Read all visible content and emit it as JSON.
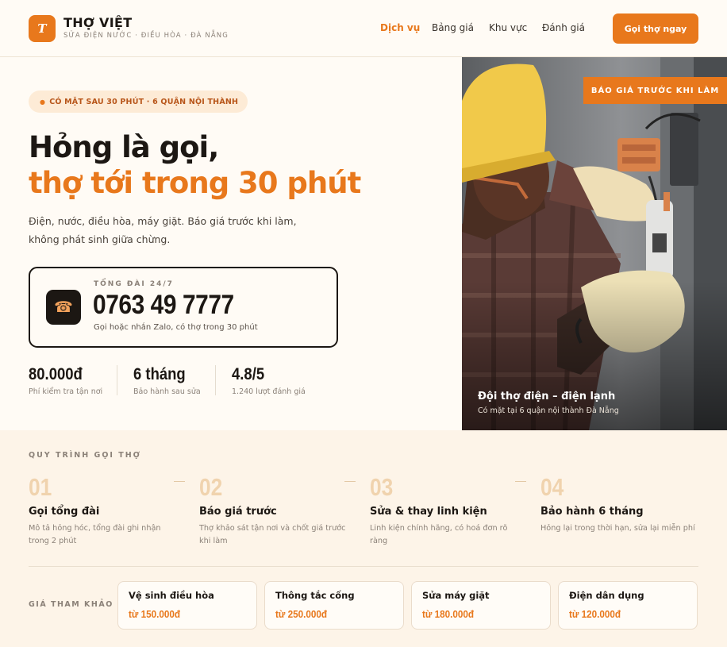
{
  "header": {
    "logo_letter": "T",
    "brand_name": "THỢ VIỆT",
    "tagline": "SỬA ĐIỆN NƯỚC · ĐIỀU HÒA · ĐÀ NẴNG",
    "nav": [
      {
        "label": "Dịch vụ",
        "active": true
      },
      {
        "label": "Bảng giá",
        "active": false
      },
      {
        "label": "Khu vực",
        "active": false
      },
      {
        "label": "Đánh giá",
        "active": false
      }
    ],
    "cta_label": "Gọi thợ ngay"
  },
  "hero": {
    "badge": "CÓ MẶT SAU 30 PHÚT · 6 QUẬN NỘI THÀNH",
    "headline_1": "Hỏng là gọi,",
    "headline_2": "thợ tới trong 30 phút",
    "description": "Điện, nước, điều hòa, máy giặt. Báo giá trước khi làm, không phát sinh giữa chừng.",
    "phone": {
      "icon": "phone-icon",
      "label": "TỔNG ĐÀI 24/7",
      "number": "0763 49 7777",
      "note": "Gọi hoặc nhắn Zalo, có thợ trong 30 phút"
    },
    "stats": [
      {
        "value": "80.000đ",
        "label": "Phí kiểm tra tận nơi"
      },
      {
        "value": "6 tháng",
        "label": "Bảo hành sau sửa"
      },
      {
        "value": "4.8/5",
        "label": "1.240 lượt đánh giá"
      }
    ],
    "image": {
      "badge": "BÁO GIÁ TRƯỚC KHI LÀM",
      "caption_title": "Đội thợ điện – điện lạnh",
      "caption_sub": "Có mặt tại 6 quận nội thành Đà Nẵng"
    }
  },
  "process": {
    "title": "QUY TRÌNH GỌI THỢ",
    "steps": [
      {
        "num": "01",
        "title": "Gọi tổng đài",
        "desc": "Mô tả hỏng hóc, tổng đài ghi nhận trong 2 phút"
      },
      {
        "num": "02",
        "title": "Báo giá trước",
        "desc": "Thợ khảo sát tận nơi và chốt giá trước khi làm"
      },
      {
        "num": "03",
        "title": "Sửa & thay linh kiện",
        "desc": "Linh kiện chính hãng, có hoá đơn rõ ràng"
      },
      {
        "num": "04",
        "title": "Bảo hành 6 tháng",
        "desc": "Hỏng lại trong thời hạn, sửa lại miễn phí"
      }
    ]
  },
  "prices": {
    "title": "GIÁ THAM KHẢO",
    "items": [
      {
        "name": "Vệ sinh điều hòa",
        "price": "từ 150.000đ"
      },
      {
        "name": "Thông tắc cống",
        "price": "từ 250.000đ"
      },
      {
        "name": "Sửa máy giặt",
        "price": "từ 180.000đ"
      },
      {
        "name": "Điện dân dụng",
        "price": "từ 120.000đ"
      }
    ]
  },
  "colors": {
    "accent": "#e8781c",
    "dark": "#1c1713",
    "cream": "#fffbf5",
    "muted": "#8b8178"
  }
}
